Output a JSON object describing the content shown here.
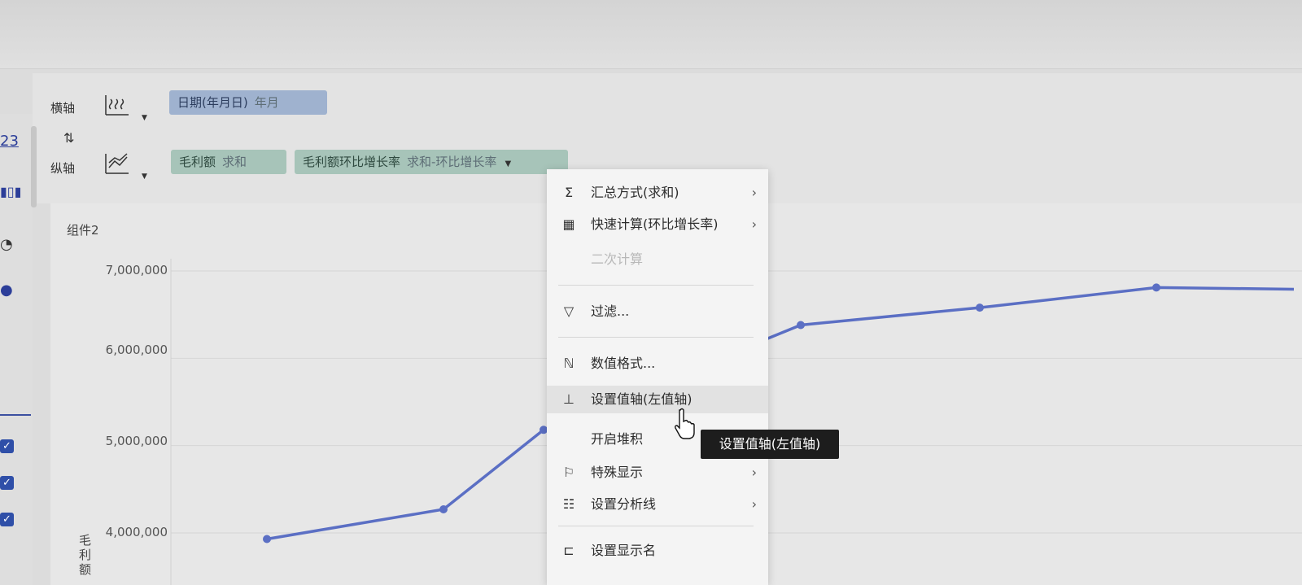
{
  "shelves": {
    "x_axis_label": "横轴",
    "y_axis_label": "纵轴",
    "swap_icon": "swap-arrows-icon",
    "x_field": {
      "name": "日期(年月日)",
      "agg": "年月"
    },
    "y_fields": [
      {
        "name": "毛利额",
        "agg": "求和"
      },
      {
        "name": "毛利额环比增长率",
        "agg": "求和-环比增长率"
      }
    ]
  },
  "left_panel": {
    "number_label": "23"
  },
  "chart": {
    "title": "组件2",
    "ylabel": "毛利额",
    "yticks": [
      "7,000,000",
      "6,000,000",
      "5,000,000",
      "4,000,000"
    ]
  },
  "chart_data": {
    "type": "line",
    "title": "组件2",
    "ylabel": "毛利额",
    "xlabel": "",
    "ylim": [
      3500000,
      7300000
    ],
    "series": [
      {
        "values": [
          3930000,
          4270000,
          5180000,
          6380000,
          6580000,
          6810000,
          6790000
        ]
      }
    ]
  },
  "menu": {
    "items": [
      {
        "icon": "sigma-icon",
        "label": "汇总方式(求和)",
        "submenu": true
      },
      {
        "icon": "calculator-icon",
        "label": "快速计算(环比增长率)",
        "submenu": true
      },
      {
        "icon": "",
        "label": "二次计算",
        "disabled": true
      },
      {
        "icon": "filter-icon",
        "label": "过滤..."
      },
      {
        "icon": "number-format-icon",
        "label": "数值格式..."
      },
      {
        "icon": "value-axis-icon",
        "label": "设置值轴(左值轴)",
        "hover": true
      },
      {
        "icon": "",
        "label": "开启堆积"
      },
      {
        "icon": "flag-icon",
        "label": "特殊显示",
        "submenu": true
      },
      {
        "icon": "analysis-line-icon",
        "label": "设置分析线",
        "submenu": true
      },
      {
        "icon": "display-name-icon",
        "label": "设置显示名"
      }
    ]
  },
  "tooltip": "设置值轴(左值轴)",
  "colors": {
    "line": "#5b6fc4",
    "pill_blue": "#9fb2cf",
    "pill_green": "#a7c4b9"
  }
}
